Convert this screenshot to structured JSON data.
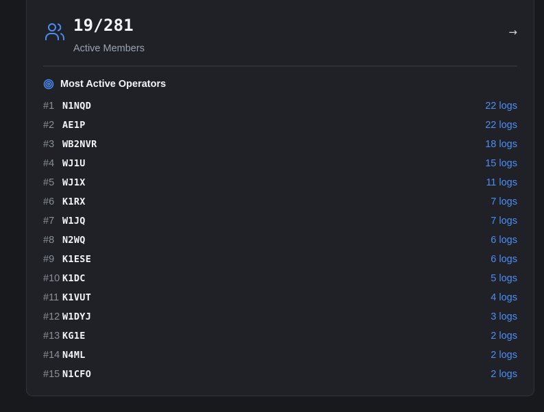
{
  "header": {
    "stat_value": "19/281",
    "stat_label": "Active Members",
    "arrow": "→"
  },
  "section": {
    "title": "Most Active Operators"
  },
  "operators": [
    {
      "rank": "#1",
      "call": "N1NQD",
      "logs": "22 logs"
    },
    {
      "rank": "#2",
      "call": "AE1P",
      "logs": "22 logs"
    },
    {
      "rank": "#3",
      "call": "WB2NVR",
      "logs": "18 logs"
    },
    {
      "rank": "#4",
      "call": "WJ1U",
      "logs": "15 logs"
    },
    {
      "rank": "#5",
      "call": "WJ1X",
      "logs": "11 logs"
    },
    {
      "rank": "#6",
      "call": "K1RX",
      "logs": "7 logs"
    },
    {
      "rank": "#7",
      "call": "W1JQ",
      "logs": "7 logs"
    },
    {
      "rank": "#8",
      "call": "N2WQ",
      "logs": "6 logs"
    },
    {
      "rank": "#9",
      "call": "K1ESE",
      "logs": "6 logs"
    },
    {
      "rank": "#10",
      "call": "K1DC",
      "logs": "5 logs"
    },
    {
      "rank": "#11",
      "call": "K1VUT",
      "logs": "4 logs"
    },
    {
      "rank": "#12",
      "call": "W1DYJ",
      "logs": "3 logs"
    },
    {
      "rank": "#13",
      "call": "KG1E",
      "logs": "2 logs"
    },
    {
      "rank": "#14",
      "call": "N4ML",
      "logs": "2 logs"
    },
    {
      "rank": "#15",
      "call": "N1CFO",
      "logs": "2 logs"
    }
  ],
  "icons": {
    "header": "users-icon",
    "section": "target-icon",
    "link": "arrow-right-icon"
  },
  "colors": {
    "accent": "#4c8ef7",
    "background": "#18191c",
    "card": "#1f2127"
  }
}
